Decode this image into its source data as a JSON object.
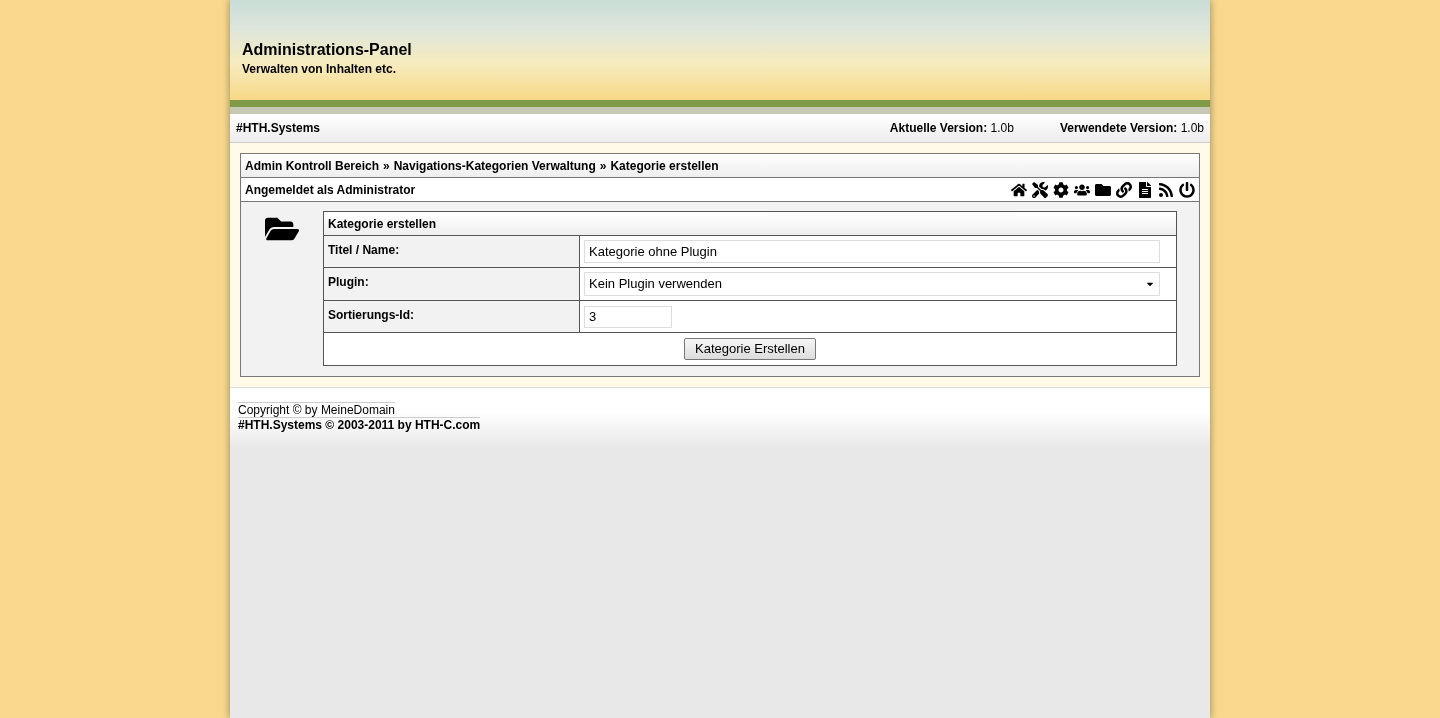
{
  "header": {
    "title": "Administrations-Panel",
    "subtitle": "Verwalten von Inhalten etc."
  },
  "topbar": {
    "brand": "#HTH.Systems",
    "versions": [
      {
        "label": "Aktuelle Version:",
        "value": "1.0b"
      },
      {
        "label": "Verwendete Version:",
        "value": "1.0b"
      }
    ]
  },
  "breadcrumb": {
    "separator": "»",
    "items": [
      "Admin Kontroll Bereich",
      "Navigations-Kategorien Verwaltung",
      "Kategorie erstellen"
    ]
  },
  "login_text": "Angemeldet als Administrator",
  "form": {
    "title": "Kategorie erstellen",
    "rows": [
      {
        "kind": "text",
        "label": "Titel / Name:",
        "value": "Kategorie ohne Plugin"
      },
      {
        "kind": "select",
        "label": "Plugin:",
        "value": "Kein Plugin verwenden"
      },
      {
        "kind": "short",
        "label": "Sortierungs-Id:",
        "value": "3"
      }
    ],
    "submit": "Kategorie Erstellen"
  },
  "footer": {
    "copyright": "Copyright © by MeineDomain",
    "credit": "#HTH.Systems © 2003-2011 by HTH-C.com"
  }
}
